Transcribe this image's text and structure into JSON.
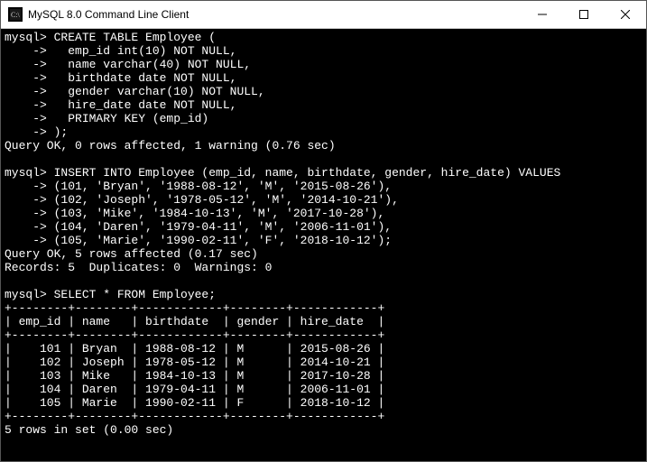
{
  "window": {
    "title": "MySQL 8.0 Command Line Client"
  },
  "prompt": "mysql>",
  "cont": "    ->",
  "create_table": {
    "cmd": "CREATE TABLE Employee (",
    "lines": [
      "  emp_id int(10) NOT NULL,",
      "  name varchar(40) NOT NULL,",
      "  birthdate date NOT NULL,",
      "  gender varchar(10) NOT NULL,",
      "  hire_date date NOT NULL,",
      "  PRIMARY KEY (emp_id)",
      ");"
    ],
    "result": "Query OK, 0 rows affected, 1 warning (0.76 sec)"
  },
  "insert": {
    "cmd": "INSERT INTO Employee (emp_id, name, birthdate, gender, hire_date) VALUES",
    "lines": [
      "(101, 'Bryan', '1988-08-12', 'M', '2015-08-26'),",
      "(102, 'Joseph', '1978-05-12', 'M', '2014-10-21'),",
      "(103, 'Mike', '1984-10-13', 'M', '2017-10-28'),",
      "(104, 'Daren', '1979-04-11', 'M', '2006-11-01'),",
      "(105, 'Marie', '1990-02-11', 'F', '2018-10-12');"
    ],
    "result1": "Query OK, 5 rows affected (0.17 sec)",
    "result2": "Records: 5  Duplicates: 0  Warnings: 0"
  },
  "select": {
    "cmd": "SELECT * FROM Employee;",
    "border": "+--------+--------+------------+--------+------------+",
    "header": "| emp_id | name   | birthdate  | gender | hire_date  |",
    "rows": [
      "|    101 | Bryan  | 1988-08-12 | M      | 2015-08-26 |",
      "|    102 | Joseph | 1978-05-12 | M      | 2014-10-21 |",
      "|    103 | Mike   | 1984-10-13 | M      | 2017-10-28 |",
      "|    104 | Daren  | 1979-04-11 | M      | 2006-11-01 |",
      "|    105 | Marie  | 1990-02-11 | F      | 2018-10-12 |"
    ],
    "result": "5 rows in set (0.00 sec)"
  }
}
